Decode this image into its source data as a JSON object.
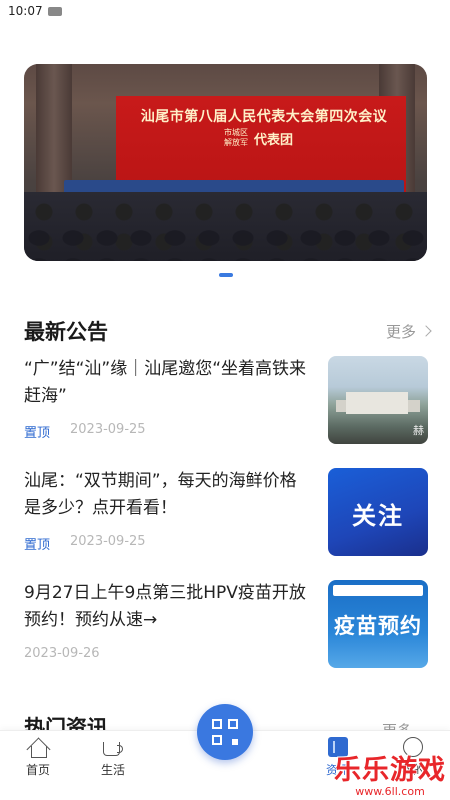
{
  "status_bar": {
    "time": "10:07"
  },
  "banner": {
    "title": "汕尾市第八届人民代表大会第四次会议",
    "sub_line1": "市城区",
    "sub_line2": "解放军",
    "sub_big": "代表团"
  },
  "announcements": {
    "title": "最新公告",
    "more": "更多",
    "items": [
      {
        "title": "“广”结“汕”缘｜汕尾邀您“坐着高铁来赶海”",
        "pin": "置顶",
        "date": "2023-09-25",
        "thumb_mark": "赫"
      },
      {
        "title": "汕尾：“双节期间”，每天的海鲜价格是多少？点开看看！",
        "pin": "置顶",
        "date": "2023-09-25",
        "thumb_word": "关注"
      },
      {
        "title": "9月27日上午9点第三批HPV疫苗开放预约！预约从速→",
        "pin": "",
        "date": "2023-09-26",
        "thumb_word": "疫苗预约"
      }
    ]
  },
  "hot": {
    "title": "热门资讯",
    "more": "更多"
  },
  "tabbar": {
    "tabs": [
      {
        "label": "首页",
        "icon": "home-icon"
      },
      {
        "label": "生活",
        "icon": "cup-icon"
      },
      {
        "label": "资讯",
        "icon": "doc-icon"
      },
      {
        "label": "我的",
        "icon": "face-icon"
      }
    ],
    "fab_icon": "qr-code-icon"
  },
  "watermark": {
    "name": "乐乐游戏",
    "url": "www.6ll.com"
  },
  "colors": {
    "accent": "#2f6ad0",
    "fab": "#3a78e0",
    "watermark": "#e8262a"
  }
}
